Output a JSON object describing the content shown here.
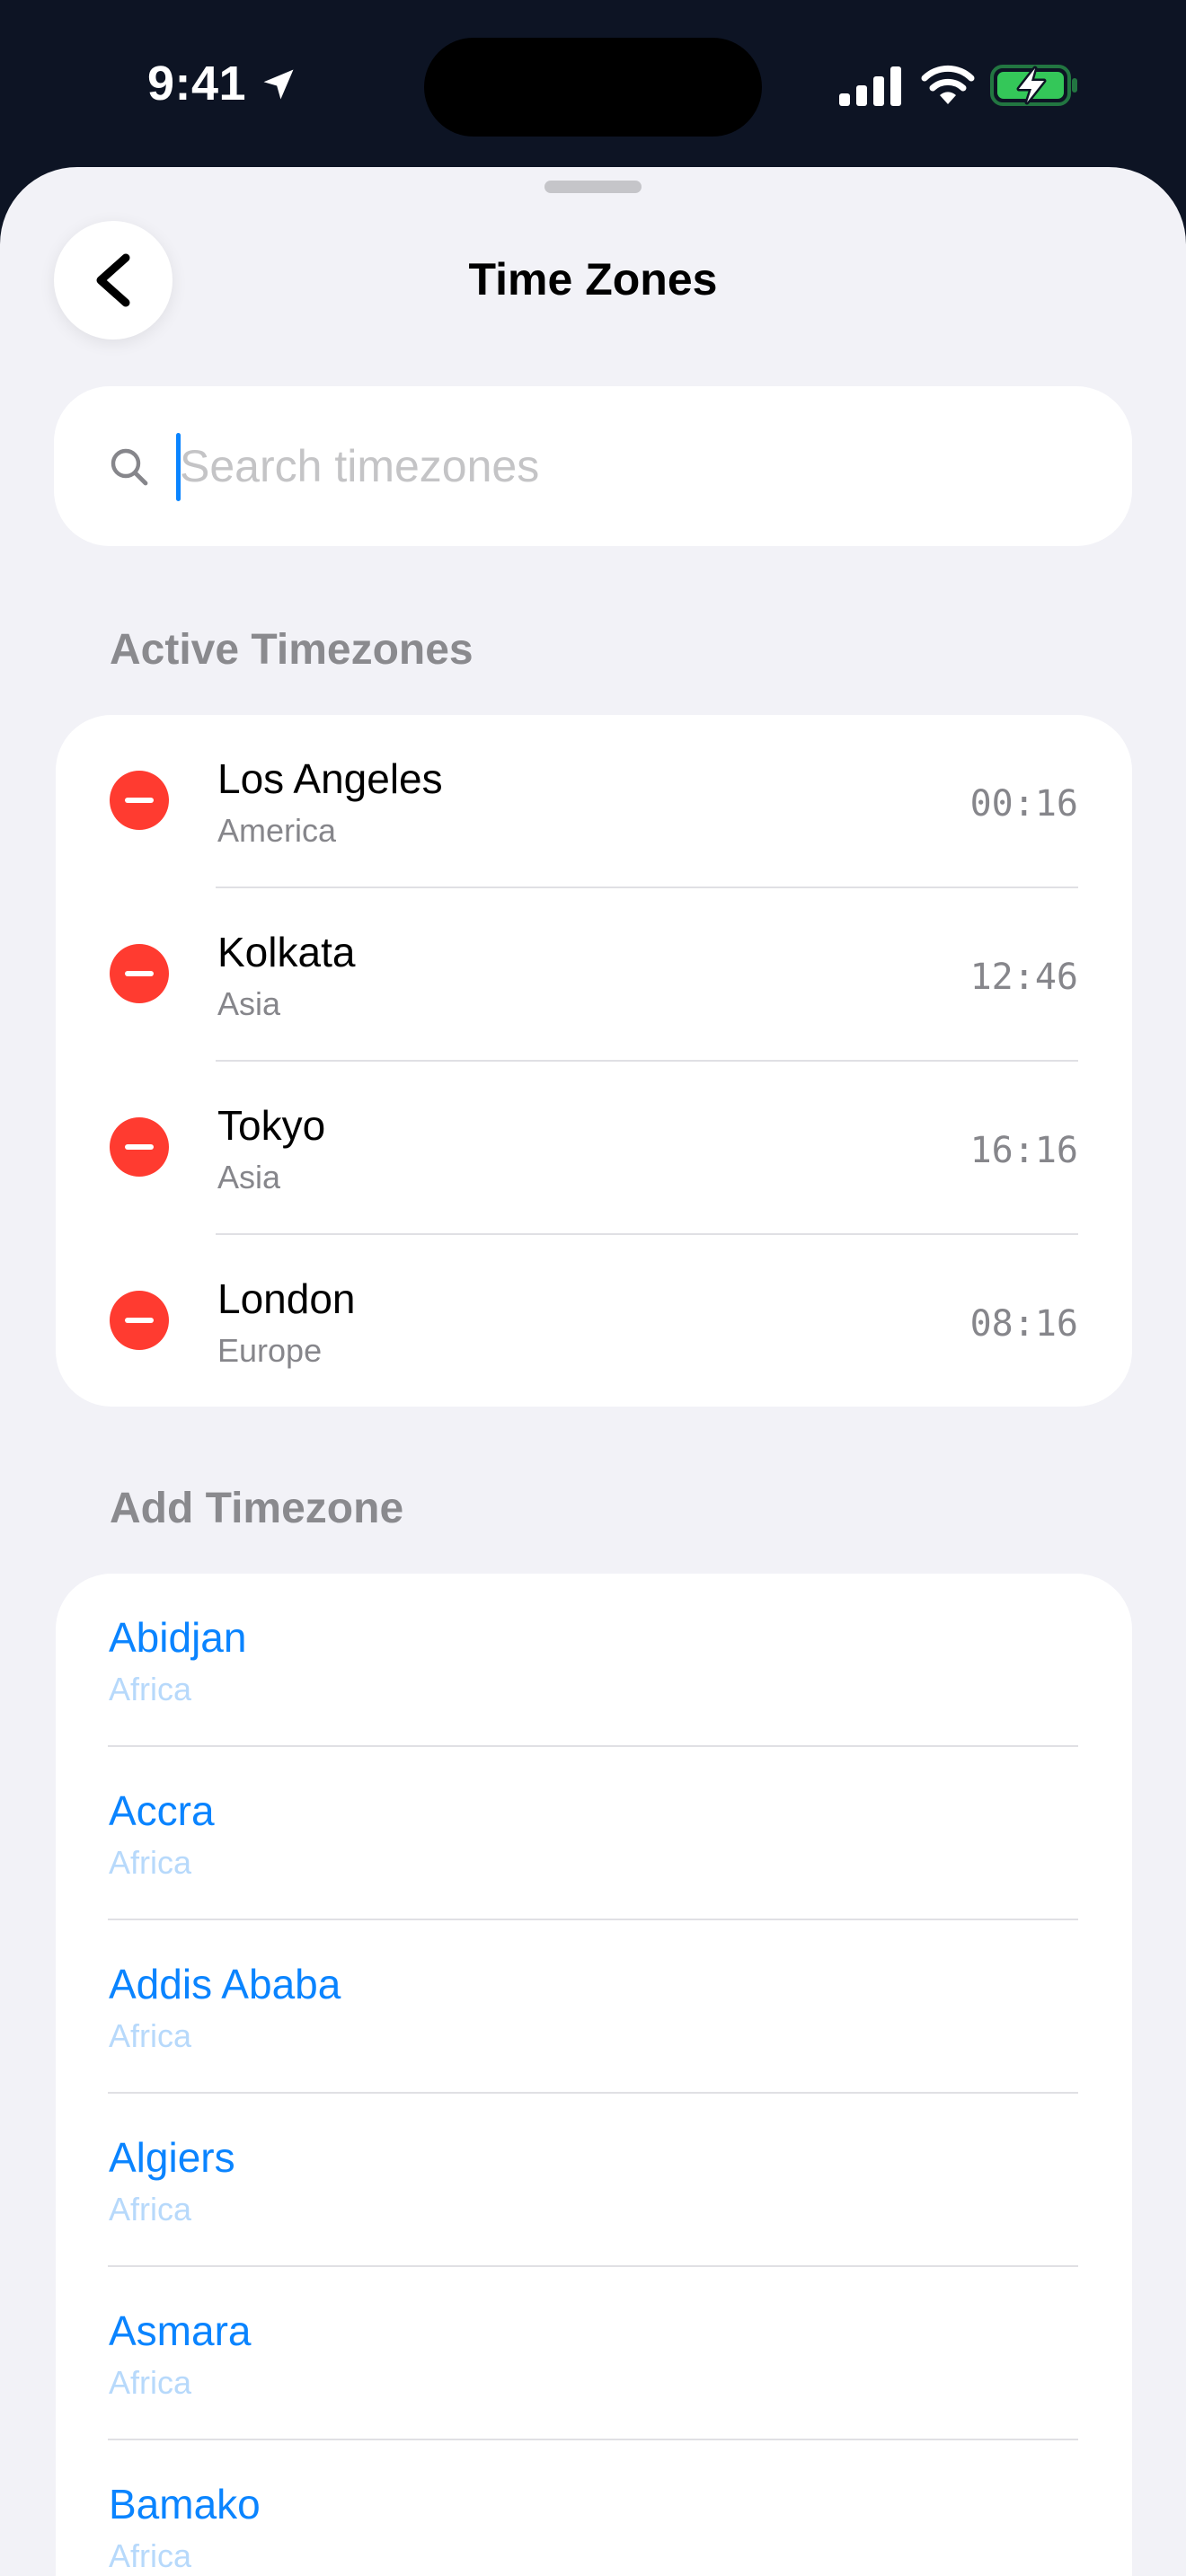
{
  "status_bar": {
    "time": "9:41"
  },
  "navigation": {
    "title": "Time Zones",
    "back_icon": "chevron-left-icon"
  },
  "search": {
    "placeholder": "Search timezones",
    "value": ""
  },
  "active_section": {
    "header": "Active Timezones",
    "items": [
      {
        "city": "Los Angeles",
        "region": "America",
        "time": "00:16"
      },
      {
        "city": "Kolkata",
        "region": "Asia",
        "time": "12:46"
      },
      {
        "city": "Tokyo",
        "region": "Asia",
        "time": "16:16"
      },
      {
        "city": "London",
        "region": "Europe",
        "time": "08:16"
      }
    ]
  },
  "add_section": {
    "header": "Add Timezone",
    "items": [
      {
        "city": "Abidjan",
        "region": "Africa"
      },
      {
        "city": "Accra",
        "region": "Africa"
      },
      {
        "city": "Addis Ababa",
        "region": "Africa"
      },
      {
        "city": "Algiers",
        "region": "Africa"
      },
      {
        "city": "Asmara",
        "region": "Africa"
      },
      {
        "city": "Bamako",
        "region": "Africa"
      }
    ]
  },
  "colors": {
    "accent": "#0a84ff",
    "remove": "#ff3b30",
    "background": "#f2f2f7",
    "status_bar": "#0d1424",
    "battery_charging": "#34c759"
  }
}
